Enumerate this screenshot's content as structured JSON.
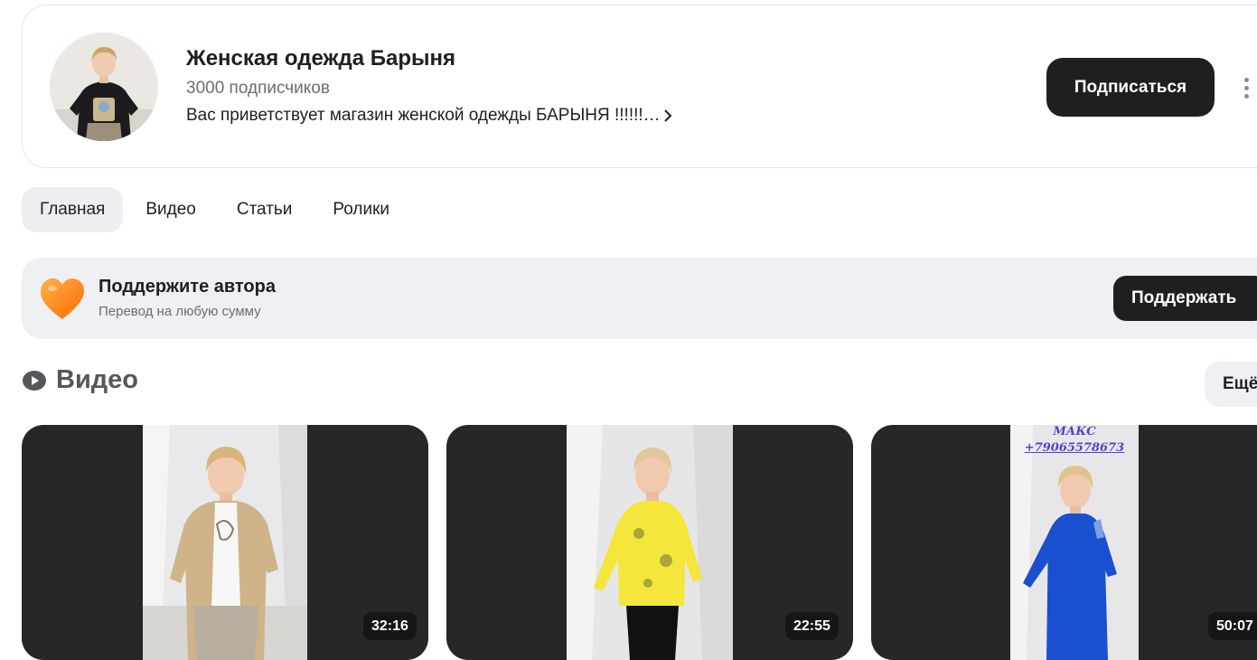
{
  "channel": {
    "title": "Женская одежда Барыня",
    "subscribers": "3000 подписчиков",
    "description": "Вас приветствует магазин женской одежды БАРЫНЯ !!!!!!…",
    "subscribe_label": "Подписаться"
  },
  "tabs": [
    {
      "label": "Главная",
      "active": true
    },
    {
      "label": "Видео",
      "active": false
    },
    {
      "label": "Статьи",
      "active": false
    },
    {
      "label": "Ролики",
      "active": false
    }
  ],
  "support": {
    "title": "Поддержите автора",
    "subtitle": "Перевод на любую сумму",
    "button_label": "Поддержать"
  },
  "videos_section": {
    "title": "Видео",
    "more_label": "Ещё"
  },
  "videos": [
    {
      "duration": "32:16",
      "outfit": "beige jacket"
    },
    {
      "duration": "22:55",
      "outfit": "yellow blouse"
    },
    {
      "duration": "50:07",
      "outfit": "blue jumpsuit",
      "overlay_line1": "МАКС",
      "overlay_line2": "+79065578673"
    }
  ],
  "colors": {
    "primary_button": "#1f1f21",
    "tab_active_bg": "#eceef2",
    "support_bg": "#eef0f3",
    "heart": "#ff8a1f",
    "video_bg": "#27272a"
  }
}
